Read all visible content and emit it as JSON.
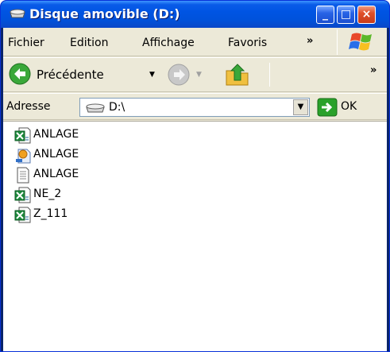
{
  "window": {
    "title": "Disque amovible (D:)",
    "buttons": {
      "minimize": "_",
      "maximize": "□",
      "close": "×"
    }
  },
  "menubar": {
    "items": [
      "Fichier",
      "Edition",
      "Affichage",
      "Favoris"
    ],
    "overflow": "»"
  },
  "toolbar": {
    "back_label": "Précédente",
    "overflow": "»"
  },
  "address": {
    "label": "Adresse",
    "value": "D:\\",
    "go_label": "OK"
  },
  "files": [
    {
      "name": "ANLAGE",
      "icon": "excel-file-icon"
    },
    {
      "name": "ANLAGE",
      "icon": "shortcut-file-icon"
    },
    {
      "name": "ANLAGE",
      "icon": "text-file-icon"
    },
    {
      "name": "NE_2",
      "icon": "excel-file-icon"
    },
    {
      "name": "Z_111",
      "icon": "excel-file-icon"
    }
  ],
  "colors": {
    "titlebar": "#0054e3",
    "chrome": "#ece9d8",
    "go_green": "#2aa12a"
  }
}
